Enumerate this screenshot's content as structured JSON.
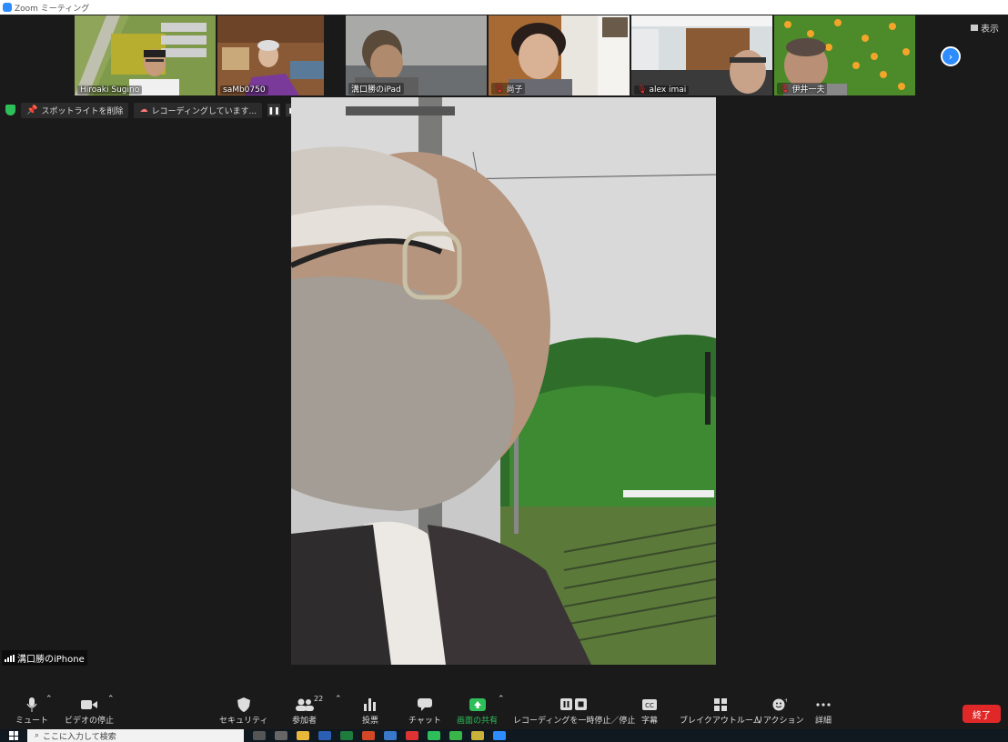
{
  "window": {
    "title": "Zoom ミーティング"
  },
  "thumbnails": [
    {
      "name": "Hiroaki Sugino",
      "muted": false
    },
    {
      "name": "saMb0750",
      "muted": false
    },
    {
      "name": "溝口勝のiPad",
      "muted": false
    },
    {
      "name": "尚子",
      "muted": true
    },
    {
      "name": "alex imai",
      "muted": true
    },
    {
      "name": "伊井一夫",
      "muted": true
    }
  ],
  "view_button": {
    "label": "表示"
  },
  "spotlight_bar": {
    "remove_spotlight": "スポットライトを削除",
    "recording_status": "レコーディングしています..."
  },
  "main_video": {
    "speaker_name": "溝口勝のiPhone"
  },
  "toolbar": {
    "mute": "ミュート",
    "stop_video": "ビデオの停止",
    "security": "セキュリティ",
    "participants": "参加者",
    "participants_count": "22",
    "polls": "投票",
    "chat": "チャット",
    "share_screen": "画面の共有",
    "recording_controls": "レコーディングを一時停止／停止",
    "captions": "字幕",
    "breakout_rooms": "ブレイクアウトルーム",
    "reactions": "リアクション",
    "more": "詳細",
    "end": "終了"
  },
  "taskbar": {
    "search_placeholder": "ここに入力して検索"
  },
  "colors": {
    "accent": "#2d8cff",
    "end": "#e02828",
    "share": "#2fbf5a",
    "background": "#1a1a1a"
  }
}
